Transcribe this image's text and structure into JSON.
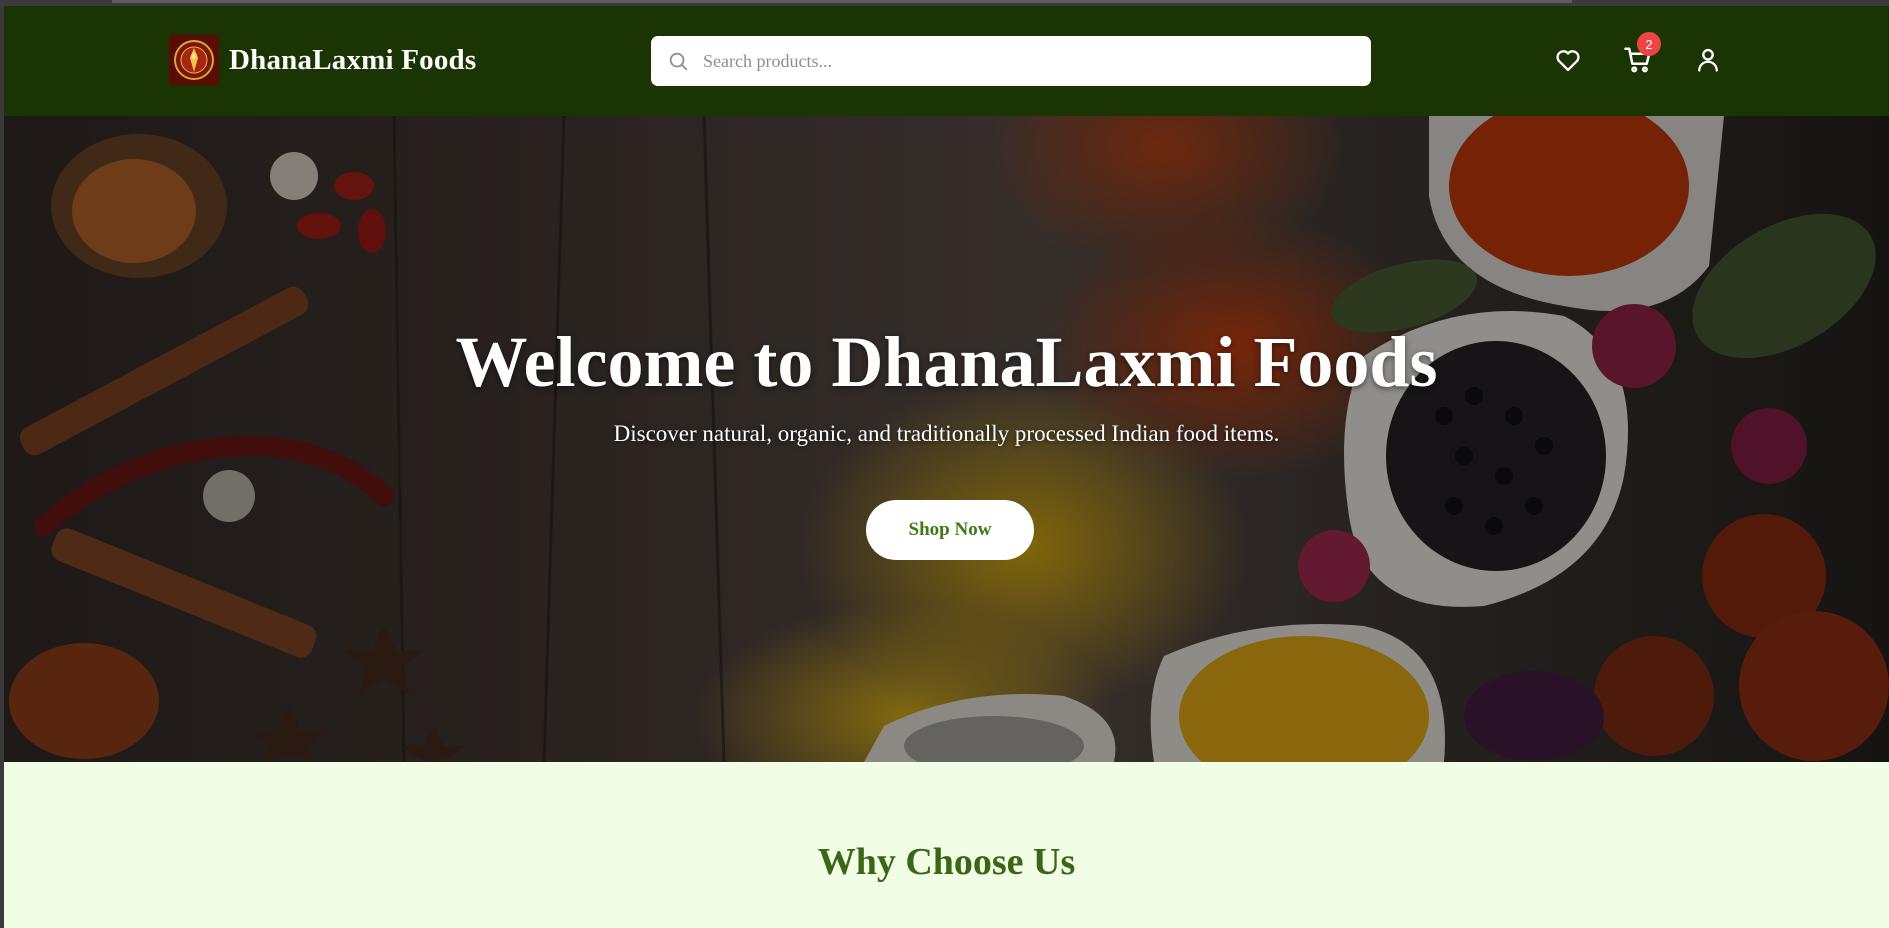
{
  "header": {
    "brand_name": "DhanaLaxmi Foods",
    "search_placeholder": "Search products...",
    "cart_count": "2",
    "icons": [
      "search-icon",
      "heart-icon",
      "cart-icon",
      "user-icon"
    ]
  },
  "hero": {
    "title": "Welcome to DhanaLaxmi Foods",
    "subtitle": "Discover natural, organic, and traditionally processed Indian food items.",
    "cta_label": "Shop Now"
  },
  "section": {
    "heading": "Why Choose Us"
  },
  "colors": {
    "header_bg": "#1b3403",
    "accent_green": "#3f7a14",
    "heading_green": "#3b6617",
    "section_bg": "#f2fde5",
    "badge_red": "#ef4444"
  }
}
